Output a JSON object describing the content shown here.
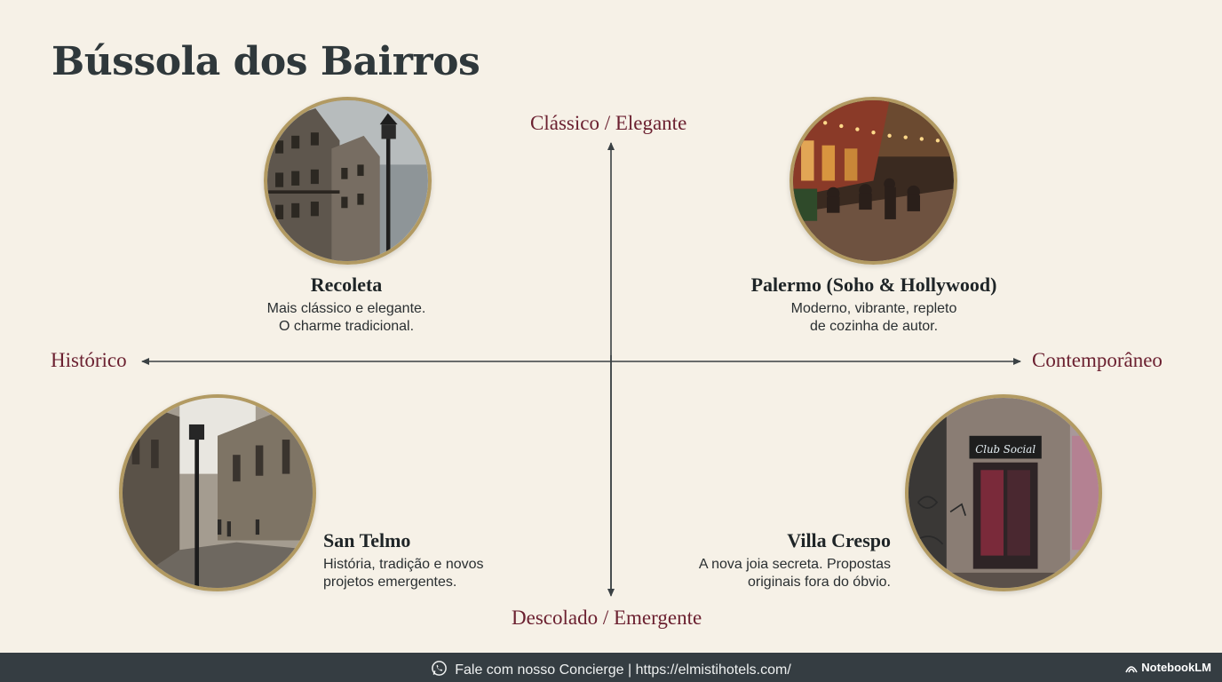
{
  "title": "Bússola dos Bairros",
  "axes": {
    "top": "Clássico / Elegante",
    "bottom": "Descolado / Emergente",
    "left": "Histórico",
    "right": "Contemporâneo"
  },
  "neighborhoods": [
    {
      "name": "Recoleta",
      "line1": "Mais clássico e elegante.",
      "line2": "O charme tradicional."
    },
    {
      "name": "Palermo (Soho & Hollywood)",
      "line1": "Moderno, vibrante, repleto",
      "line2": "de cozinha de autor."
    },
    {
      "name": "San Telmo",
      "line1": "História, tradição e novos",
      "line2": "projetos emergentes."
    },
    {
      "name": "Villa Crespo",
      "line1": "A nova joia secreta. Propostas",
      "line2": "originais fora do óbvio.",
      "sign_text": "Club Social"
    }
  ],
  "footer": {
    "text": "Fale com nosso Concierge | https://elmistihotels.com/",
    "brand": "NotebookLM",
    "icon": "whatsapp-icon"
  },
  "colors": {
    "background": "#f6f1e7",
    "axis_label": "#6b2030",
    "photo_border": "#b29a62",
    "footer_bg": "#353d42"
  }
}
